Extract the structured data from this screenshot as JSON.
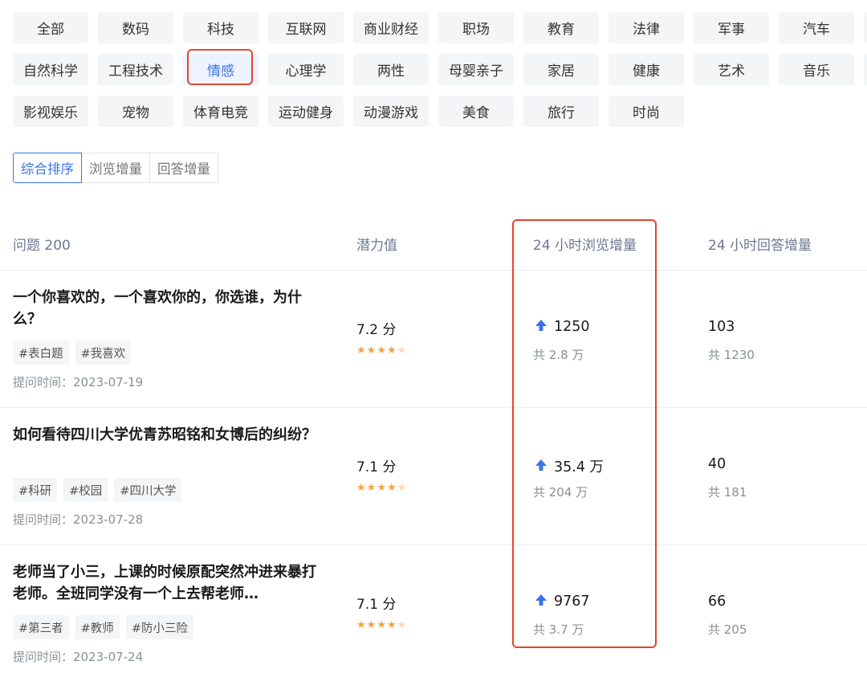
{
  "categories": [
    [
      "全部",
      "数码",
      "科技",
      "互联网",
      "商业财经",
      "职场",
      "教育",
      "法律",
      "军事",
      "汽车"
    ],
    [
      "自然科学",
      "工程技术",
      "情感",
      "心理学",
      "两性",
      "母婴亲子",
      "家居",
      "健康",
      "艺术",
      "音乐"
    ],
    [
      "影视娱乐",
      "宠物",
      "体育电竞",
      "运动健身",
      "动漫游戏",
      "美食",
      "旅行",
      "时尚"
    ]
  ],
  "active_category": "情感",
  "sort_tabs": [
    "综合排序",
    "浏览增量",
    "回答增量"
  ],
  "active_sort": "综合排序",
  "table_header": {
    "question": "问题 200",
    "potential": "潜力值",
    "views_24h": "24 小时浏览增量",
    "answers_24h": "24 小时回答增量"
  },
  "rows": [
    {
      "title": "一个你喜欢的，一个喜欢你的，你选谁，为什么？",
      "tags": [
        "#表白题",
        "#我喜欢"
      ],
      "asked": "提问时间：2023-07-19",
      "score": "7.2 分",
      "stars": 4,
      "views": "1250",
      "views_total": "共 2.8 万",
      "answers": "103",
      "answers_total": "共 1230"
    },
    {
      "title": "如何看待四川大学优青苏昭铭和女博后的纠纷？",
      "tags": [
        "#科研",
        "#校园",
        "#四川大学"
      ],
      "asked": "提问时间：2023-07-28",
      "score": "7.1 分",
      "stars": 4,
      "views": "35.4 万",
      "views_total": "共 204 万",
      "answers": "40",
      "answers_total": "共 181"
    },
    {
      "title": "老师当了小三，上课的时候原配突然冲进来暴打老师。全班同学没有一个上去帮老师…",
      "tags": [
        "#第三者",
        "#教师",
        "#防小三险"
      ],
      "asked": "提问时间：2023-07-24",
      "score": "7.1 分",
      "stars": 4,
      "views": "9767",
      "views_total": "共 3.7 万",
      "answers": "66",
      "answers_total": "共 205"
    }
  ],
  "colors": {
    "accent": "#3b73e6",
    "highlight": "#e2452f",
    "star": "#f3a23e"
  }
}
